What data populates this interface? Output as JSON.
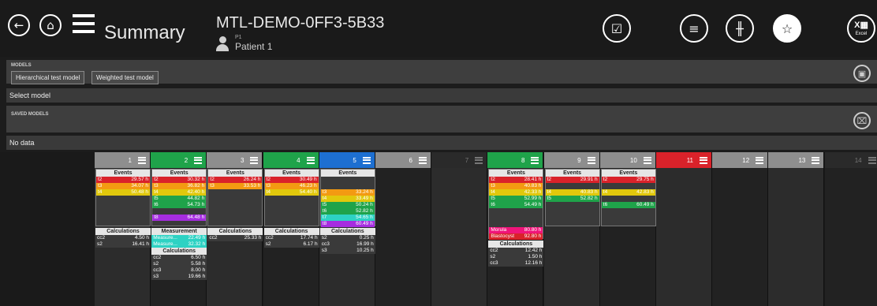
{
  "header": {
    "title": "Summary",
    "slide_id": "MTL-DEMO-0FF3-5B33",
    "patient_code": "P1",
    "patient_name": "Patient 1",
    "excel_label": "Excel"
  },
  "models": {
    "section_label": "MODELS",
    "buttons": [
      "Hierarchical test model",
      "Weighted test model"
    ],
    "select_label": "Select model"
  },
  "saved_models": {
    "section_label": "SAVED MODELS",
    "empty_label": "No data"
  },
  "colors": {
    "green": "#1fa34a",
    "blue": "#1d6fd1",
    "red": "#d9222a",
    "orange": "#f39a12",
    "yellow": "#e1c80c",
    "teal": "#2dd2c3",
    "purple": "#a62de0",
    "pink": "#f0147a",
    "grey": "#9a9a9a"
  },
  "wells": [
    {
      "number": "1",
      "status": "grey",
      "events": [
        [
          "t2",
          "29.57 h",
          "red"
        ],
        [
          "t3",
          "34.07 h",
          "orange"
        ],
        [
          "t4",
          "50.48 h",
          "yellow"
        ]
      ],
      "calculations": [
        [
          "cc2",
          "4.50 h"
        ],
        [
          "s2",
          "16.41 h"
        ]
      ]
    },
    {
      "number": "2",
      "status": "green",
      "events": [
        [
          "t2",
          "30.32 h",
          "red"
        ],
        [
          "t3",
          "36.82 h",
          "orange"
        ],
        [
          "t4",
          "42.40 h",
          "yellow"
        ],
        [
          "t5",
          "44.82 h",
          "green"
        ],
        [
          "t6",
          "54.73 h",
          "green"
        ],
        [
          "",
          "",
          " "
        ],
        [
          "t8",
          "64.48 h",
          "purple"
        ]
      ],
      "measurement_label": "Measurement",
      "measurements": [
        [
          "Measure...",
          "22.49 h",
          "teal"
        ],
        [
          "Measure...",
          "32.32 h",
          "teal"
        ]
      ],
      "calculations": [
        [
          "cc2",
          "6.50 h"
        ],
        [
          "s2",
          "5.58 h"
        ],
        [
          "cc3",
          "8.00 h"
        ],
        [
          "s3",
          "19.66 h"
        ]
      ]
    },
    {
      "number": "3",
      "status": "grey",
      "events": [
        [
          "t2",
          "26.24 h",
          "red"
        ],
        [
          "t3",
          "33.53 h",
          "orange"
        ]
      ],
      "calculations": [
        [
          "cc2",
          "25.33 h"
        ]
      ]
    },
    {
      "number": "4",
      "status": "green",
      "events": [
        [
          "t2",
          "30.49 h",
          "red"
        ],
        [
          "t3",
          "46.23 h",
          "orange"
        ],
        [
          "t4",
          "54.40 h",
          "yellow"
        ]
      ],
      "calculations": [
        [
          "cc2",
          "17.74 h"
        ],
        [
          "s2",
          "6.17 h"
        ]
      ]
    },
    {
      "number": "5",
      "status": "blue",
      "events": [
        [
          "",
          "",
          ""
        ],
        [
          "",
          "",
          ""
        ],
        [
          "t3",
          "33.24 h",
          "orange"
        ],
        [
          "t4",
          "33.49 h",
          "yellow"
        ],
        [
          "t5",
          "50.24 h",
          "green"
        ],
        [
          "t6",
          "52.82 h",
          "green"
        ],
        [
          "t7",
          "54.65 h",
          "teal"
        ],
        [
          "t8",
          "60.49 h",
          "purple"
        ]
      ],
      "calculations": [
        [
          "s2",
          "0.25 h"
        ],
        [
          "cc3",
          "16.99 h"
        ],
        [
          "s3",
          "10.25 h"
        ]
      ]
    },
    {
      "number": "6",
      "status": "grey"
    },
    {
      "number": "7",
      "status": "dark"
    },
    {
      "number": "8",
      "status": "green",
      "events": [
        [
          "t2",
          "28.41 h",
          "red"
        ],
        [
          "t3",
          "40.83 h",
          "orange"
        ],
        [
          "t4",
          "42.33 h",
          "yellow"
        ],
        [
          "t5",
          "52.99 h",
          "green"
        ],
        [
          "t6",
          "54.49 h",
          "green"
        ]
      ],
      "extra_events": [
        [
          "Morula",
          "80.80 h",
          "pink"
        ],
        [
          "Blastocyst",
          "92.80 h",
          "red"
        ]
      ],
      "calculations": [
        [
          "cc2",
          "12.42 h"
        ],
        [
          "s2",
          "1.50 h"
        ],
        [
          "cc3",
          "12.16 h"
        ]
      ]
    },
    {
      "number": "9",
      "status": "grey",
      "events": [
        [
          "t2",
          "29.91 h",
          "red"
        ],
        [
          "",
          "",
          ""
        ],
        [
          "t4",
          "40.83 h",
          "yellow"
        ],
        [
          "t5",
          "52.82 h",
          "green"
        ]
      ]
    },
    {
      "number": "10",
      "status": "grey",
      "events": [
        [
          "t2",
          "29.75 h",
          "red"
        ],
        [
          "",
          "",
          ""
        ],
        [
          "t4",
          "42.83 h",
          "yellow"
        ],
        [
          "",
          "",
          ""
        ],
        [
          "t6",
          "60.49 h",
          "green"
        ]
      ]
    },
    {
      "number": "11",
      "status": "red"
    },
    {
      "number": "12",
      "status": "grey"
    },
    {
      "number": "13",
      "status": "grey"
    },
    {
      "number": "14",
      "status": "dark"
    }
  ],
  "labels": {
    "events": "Events",
    "calculations": "Calculations"
  }
}
